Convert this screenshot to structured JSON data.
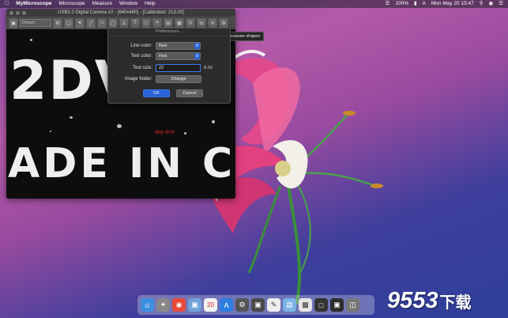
{
  "menubar": {
    "apple_icon": "apple-icon",
    "app_name": "MyMicroscope",
    "menus": [
      "Microscope",
      "Measure",
      "Window",
      "Help"
    ],
    "battery": "100%",
    "datetime": "Mon May 20  15:47"
  },
  "app_window": {
    "title": "USB2.0 Digital Camera #2 - [640x480] - [Calibrated: 213.00]",
    "camera_select": "Default",
    "image_text_line1": "2DV",
    "image_text_line2": "ADE IN C",
    "any_text_label": "any text"
  },
  "tooltip": {
    "text": "Delete all measure shapes"
  },
  "preferences": {
    "title": "Preferences...",
    "line_color_label": "Line color:",
    "line_color_value": "Red",
    "text_color_label": "Text color:",
    "text_color_value": "Red",
    "text_size_label": "Text size:",
    "text_size_value": "22",
    "text_size_range": "8-50",
    "image_folder_label": "Image folder:",
    "change_button": "Change",
    "ok_button": "OK",
    "cancel_button": "Cancel"
  },
  "dock": {
    "calendar_day": "20"
  },
  "watermark": {
    "number": "9553",
    "suffix": "下载"
  },
  "colors": {
    "accent": "#2a62d8",
    "any_text": "#dd2222"
  }
}
